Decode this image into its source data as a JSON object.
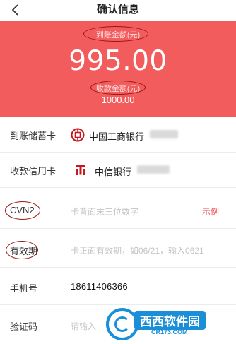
{
  "header": {
    "title": "确认信息"
  },
  "summary": {
    "arrival_label": "到账金额(元)",
    "arrival_amount": "995.00",
    "collect_label": "收款金额(元)",
    "collect_amount": "1000.00",
    "background_color": "#f25c5c"
  },
  "form": {
    "debit_card": {
      "label": "到账储蓄卡",
      "bank_name": "中国工商银行",
      "bank_icon": "icbc-logo-icon"
    },
    "credit_card": {
      "label": "收款信用卡",
      "bank_name": "中信银行",
      "bank_icon": "citic-logo-icon"
    },
    "cvn2": {
      "label": "CVN2",
      "placeholder": "卡背面末三位数字",
      "example_link": "示例"
    },
    "expiry": {
      "label": "有效期",
      "placeholder": "卡正面有效期，如06/21，输入0621"
    },
    "phone": {
      "label": "手机号",
      "value": "18611406366"
    },
    "verify_code": {
      "label": "验证码",
      "placeholder": "请输入"
    }
  },
  "watermark": {
    "title": "西西软件园",
    "url": "CR173.COM"
  },
  "colors": {
    "accent": "#f25c5c",
    "link": "#e84c4c",
    "annotation": "#9b1414",
    "watermark": "#1a8fd8"
  }
}
